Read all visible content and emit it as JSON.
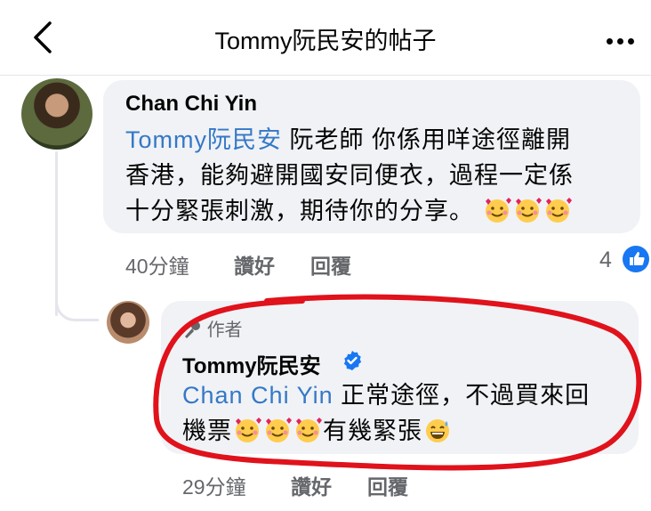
{
  "header": {
    "title": "Tommy阮民安的帖子",
    "back_icon": "chevron-left-icon",
    "more_icon": "more-horizontal-icon"
  },
  "comment": {
    "author": "Chan Chi Yin",
    "mention": "Tommy阮民安",
    "line1_rest": " 阮老師 你係用咩途徑離開",
    "line2": "香港，能夠避開國安同便衣，過程一定係",
    "line3": "十分緊張刺激，期待你的分享。",
    "time": "40分鐘",
    "like_label": "讚好",
    "reply_label": "回覆",
    "reaction_count": "4",
    "reaction_icon": "thumbs-up-icon",
    "emoji_icon": "smiling-face-with-hearts-icon"
  },
  "reply": {
    "badge_label": "作者",
    "badge_icon": "microphone-icon",
    "author": "Tommy阮民安",
    "verified_icon": "verified-badge-icon",
    "mention": "Chan Chi Yin",
    "line1_rest": " 正常途徑，不過買來回",
    "line2_start": "機票",
    "line2_end": "有幾緊張",
    "sweat_emoji_icon": "grinning-face-with-sweat-icon",
    "time": "29分鐘",
    "like_label": "讚好",
    "reply_label": "回覆"
  },
  "colors": {
    "accent": "#1877f2",
    "mention": "#3578c7",
    "bubble": "#f0f2f5",
    "muted": "#65676b",
    "highlight_circle": "#e0121b"
  }
}
